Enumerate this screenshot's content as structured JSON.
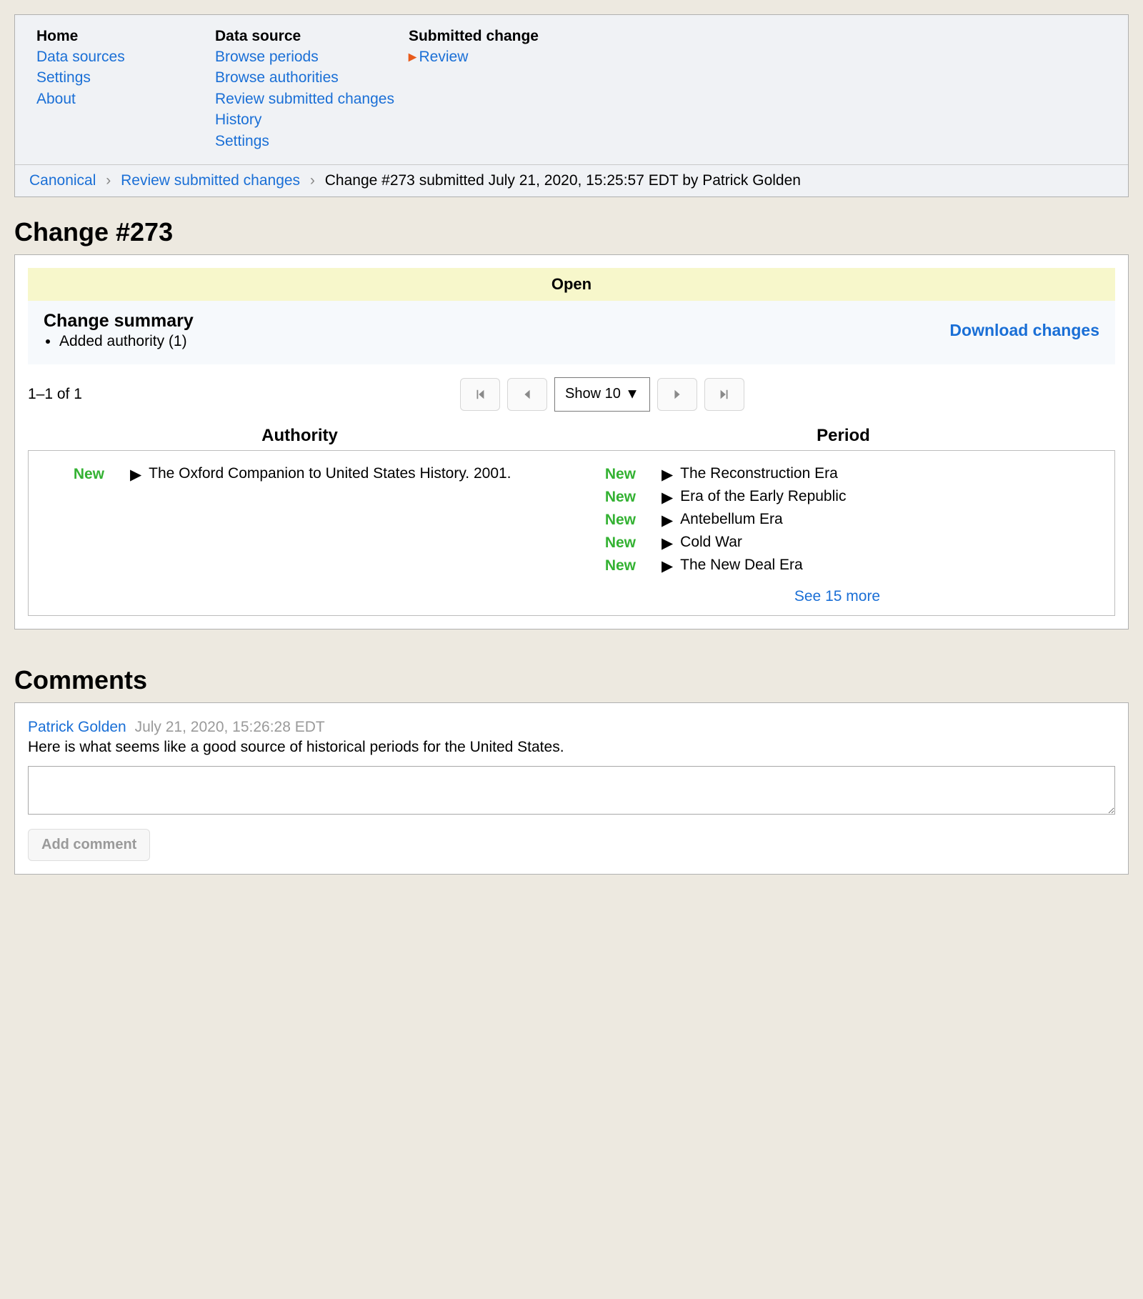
{
  "nav": {
    "cols": [
      {
        "head": "Home",
        "items": [
          "Data sources",
          "Settings",
          "About"
        ]
      },
      {
        "head": "Data source",
        "items": [
          "Browse periods",
          "Browse authorities",
          "Review submitted changes",
          "History",
          "Settings"
        ]
      },
      {
        "head": "Submitted change",
        "items": [
          "Review"
        ],
        "active": true
      }
    ]
  },
  "breadcrumb": {
    "items": [
      "Canonical",
      "Review submitted changes"
    ],
    "current": "Change #273 submitted July 21, 2020, 15:25:57 EDT by Patrick Golden"
  },
  "page_title": "Change #273",
  "status": "Open",
  "summary": {
    "title": "Change summary",
    "items": [
      "Added authority (1)"
    ]
  },
  "download_label": "Download changes",
  "pager": {
    "count_text": "1–1 of 1",
    "select_label": "Show 10"
  },
  "columns": {
    "left": "Authority",
    "right": "Period"
  },
  "authority_items": [
    {
      "tag": "New",
      "text": "The Oxford Companion to United States History. 2001."
    }
  ],
  "period_items": [
    {
      "tag": "New",
      "text": "The Reconstruction Era"
    },
    {
      "tag": "New",
      "text": "Era of the Early Republic"
    },
    {
      "tag": "New",
      "text": "Antebellum Era"
    },
    {
      "tag": "New",
      "text": "Cold War"
    },
    {
      "tag": "New",
      "text": "The New Deal Era"
    }
  ],
  "see_more": "See 15 more",
  "comments_title": "Comments",
  "comments": [
    {
      "author": "Patrick Golden",
      "date": "July 21, 2020, 15:26:28 EDT",
      "body": "Here is what seems like a good source of historical periods for the United States."
    }
  ],
  "add_comment_label": "Add comment"
}
